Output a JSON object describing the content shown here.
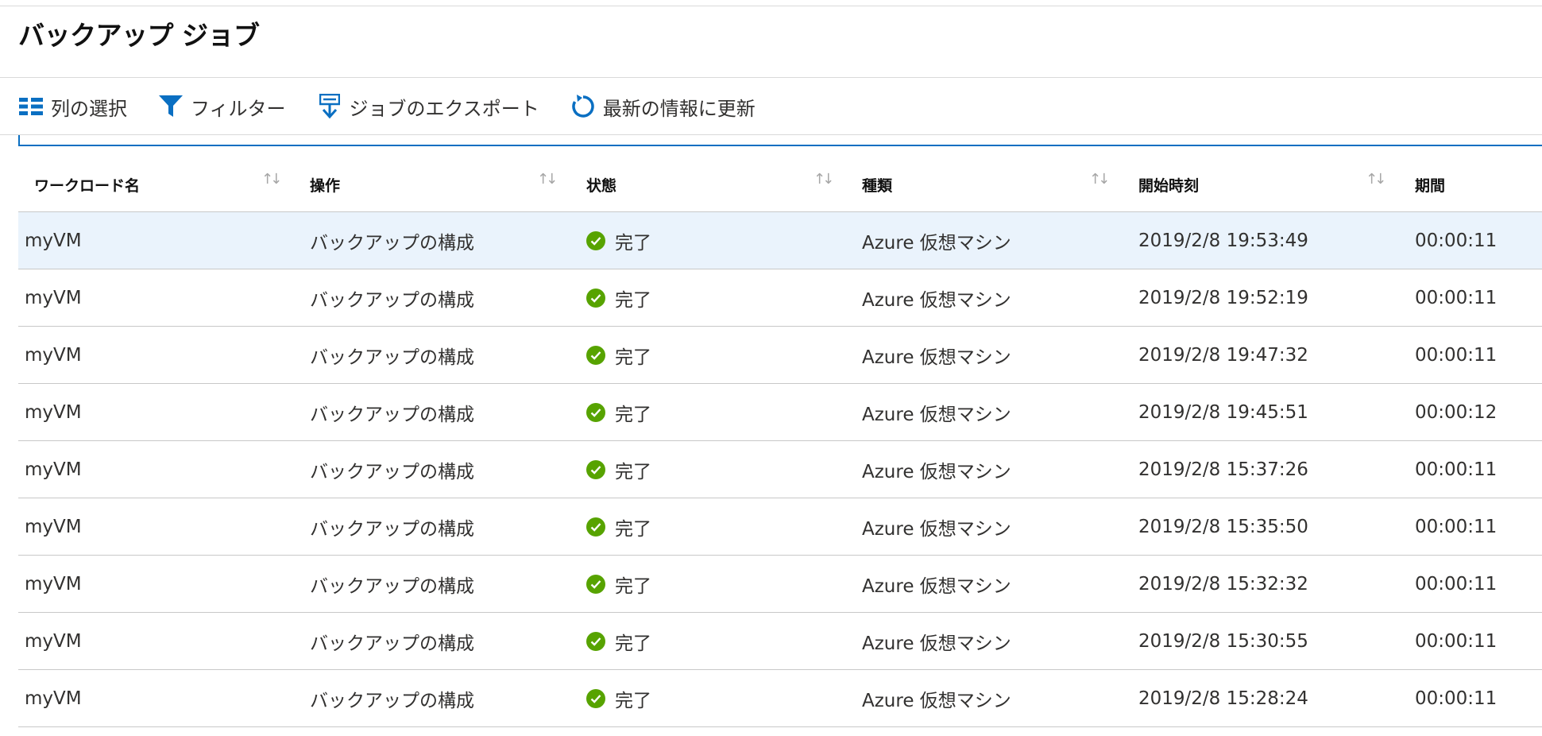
{
  "page": {
    "title": "バックアップ ジョブ"
  },
  "toolbar": {
    "columns_label": "列の選択",
    "filter_label": "フィルター",
    "export_label": "ジョブのエクスポート",
    "refresh_label": "最新の情報に更新"
  },
  "table": {
    "columns": [
      "ワークロード名",
      "操作",
      "状態",
      "種類",
      "開始時刻",
      "期間"
    ],
    "rows": [
      {
        "workload": "myVM",
        "operation": "バックアップの構成",
        "status": "完了",
        "type": "Azure 仮想マシン",
        "start": "2019/2/8 19:53:49",
        "duration": "00:00:11",
        "selected": true
      },
      {
        "workload": "myVM",
        "operation": "バックアップの構成",
        "status": "完了",
        "type": "Azure 仮想マシン",
        "start": "2019/2/8 19:52:19",
        "duration": "00:00:11"
      },
      {
        "workload": "myVM",
        "operation": "バックアップの構成",
        "status": "完了",
        "type": "Azure 仮想マシン",
        "start": "2019/2/8 19:47:32",
        "duration": "00:00:11"
      },
      {
        "workload": "myVM",
        "operation": "バックアップの構成",
        "status": "完了",
        "type": "Azure 仮想マシン",
        "start": "2019/2/8 19:45:51",
        "duration": "00:00:12"
      },
      {
        "workload": "myVM",
        "operation": "バックアップの構成",
        "status": "完了",
        "type": "Azure 仮想マシン",
        "start": "2019/2/8 15:37:26",
        "duration": "00:00:11"
      },
      {
        "workload": "myVM",
        "operation": "バックアップの構成",
        "status": "完了",
        "type": "Azure 仮想マシン",
        "start": "2019/2/8 15:35:50",
        "duration": "00:00:11"
      },
      {
        "workload": "myVM",
        "operation": "バックアップの構成",
        "status": "完了",
        "type": "Azure 仮想マシン",
        "start": "2019/2/8 15:32:32",
        "duration": "00:00:11"
      },
      {
        "workload": "myVM",
        "operation": "バックアップの構成",
        "status": "完了",
        "type": "Azure 仮想マシン",
        "start": "2019/2/8 15:30:55",
        "duration": "00:00:11"
      },
      {
        "workload": "myVM",
        "operation": "バックアップの構成",
        "status": "完了",
        "type": "Azure 仮想マシン",
        "start": "2019/2/8 15:28:24",
        "duration": "00:00:11"
      }
    ]
  },
  "icons": {
    "columns": "columns-icon",
    "filter": "filter-icon",
    "export": "export-icon",
    "refresh": "refresh-icon",
    "status_success": "success-check-icon",
    "sort": "sort-arrows-icon"
  },
  "colors": {
    "accent": "#0a6fc2",
    "success": "#57a300",
    "selected_row": "#eaf3fc"
  }
}
